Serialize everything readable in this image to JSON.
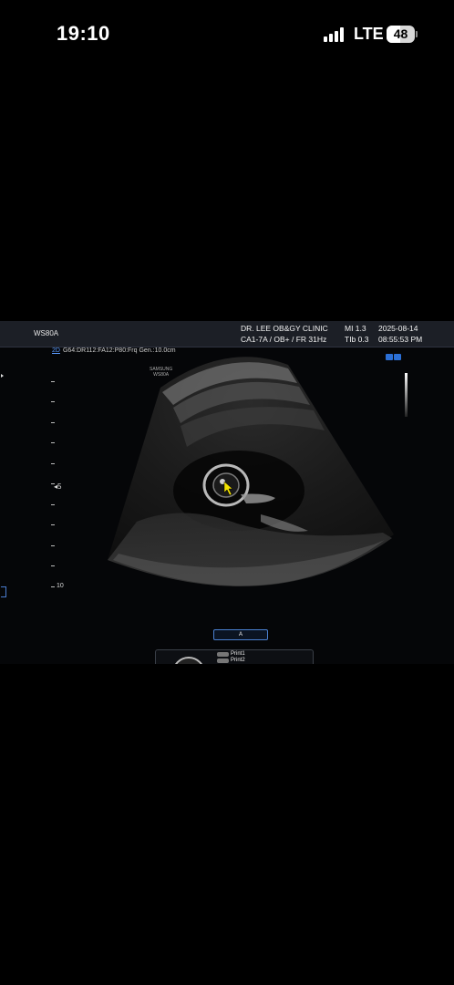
{
  "status_bar": {
    "time": "19:10",
    "network": "LTE",
    "battery": "48"
  },
  "ultrasound": {
    "model": "WS80A",
    "clinic": "DR. LEE OB&GY CLINIC",
    "probe": "CA1-7A / OB+ / FR 31Hz",
    "mi": "MI  1.3",
    "tib": "TIb 0.3",
    "date": "2025-08-14",
    "clock": "08:55:53 PM",
    "mode": "2D",
    "params": "G64:DR112:FA12:P80:Frq Gen.:10.0cm",
    "depth_label_max": "10",
    "focus_label": "5",
    "brand_line1": "SAMSUNG",
    "brand_line2": "WS80A",
    "a_button": "A",
    "print1": "Print1",
    "print2": "Print2",
    "accent_color": "#4a80d0",
    "cursor_color": "#f2e200"
  }
}
